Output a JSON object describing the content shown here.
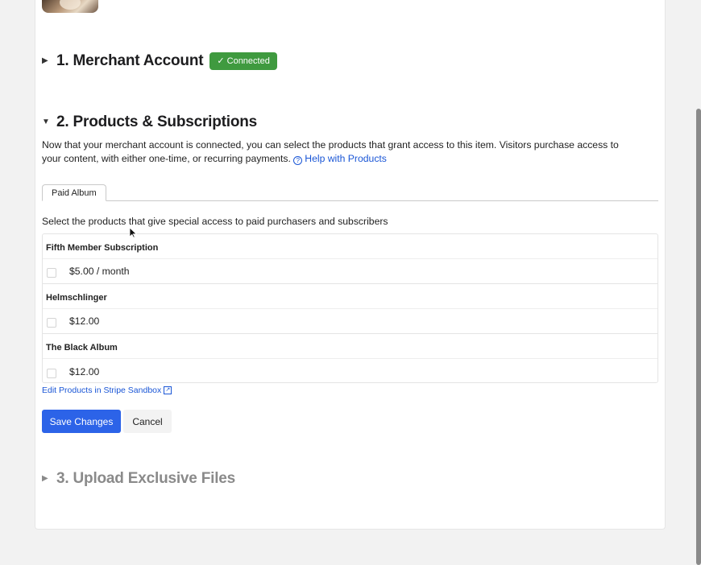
{
  "sections": {
    "merchant": {
      "title": "1. Merchant Account",
      "badge": "✓ Connected",
      "expanded": false
    },
    "products": {
      "title": "2. Products & Subscriptions",
      "expanded": true
    },
    "upload": {
      "title": "3. Upload Exclusive Files",
      "expanded": false
    }
  },
  "products_section": {
    "description": "Now that your merchant account is connected, you can select the products that grant access to this item. Visitors purchase access to your content, with either one-time, or recurring payments.",
    "help_link": "Help with Products",
    "tab_label": "Paid Album",
    "instructions": "Select the products that give special access to paid purchasers and subscribers",
    "groups": [
      {
        "name": "Fifth Member Subscription",
        "price": "$5.00 / month",
        "checked": false
      },
      {
        "name": "Helmschlinger",
        "price": "$12.00",
        "checked": false
      },
      {
        "name": "The Black Album",
        "price": "$12.00",
        "checked": false
      }
    ],
    "edit_link": "Edit Products in Stripe Sandbox",
    "save_label": "Save Changes",
    "cancel_label": "Cancel"
  },
  "icons": {
    "collapsed": "triangle-right-icon",
    "expanded": "triangle-down-icon",
    "help": "help-circle-icon",
    "external": "external-link-icon"
  },
  "colors": {
    "accent": "#2c63e8",
    "link": "#1a56d6",
    "success": "#3f9a3f"
  }
}
